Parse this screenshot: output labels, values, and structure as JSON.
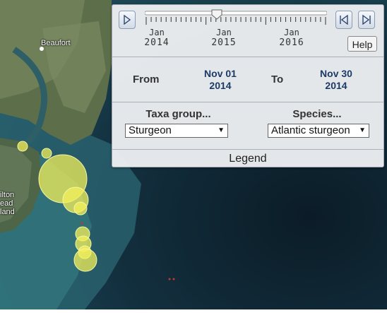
{
  "map": {
    "places": [
      "Beaufort",
      "ilton",
      "ead",
      "land"
    ],
    "marker_color": "#f3f05a"
  },
  "timeline": {
    "ticks": [
      {
        "month": "Jan",
        "year": "2014"
      },
      {
        "month": "Jan",
        "year": "2015"
      },
      {
        "month": "Jan",
        "year": "2016"
      }
    ],
    "play_icon": "play-icon",
    "step_back_icon": "step-back-icon",
    "step_forward_icon": "step-forward-icon",
    "help_label": "Help"
  },
  "date_range": {
    "from_label": "From",
    "from_value": [
      "Nov 01",
      "2014"
    ],
    "to_label": "To",
    "to_value": [
      "Nov 30",
      "2014"
    ]
  },
  "filters": {
    "taxa_label": "Taxa group...",
    "taxa_selected": "Sturgeon",
    "species_label": "Species...",
    "species_selected": "Atlantic sturgeon"
  },
  "legend_label": "Legend"
}
